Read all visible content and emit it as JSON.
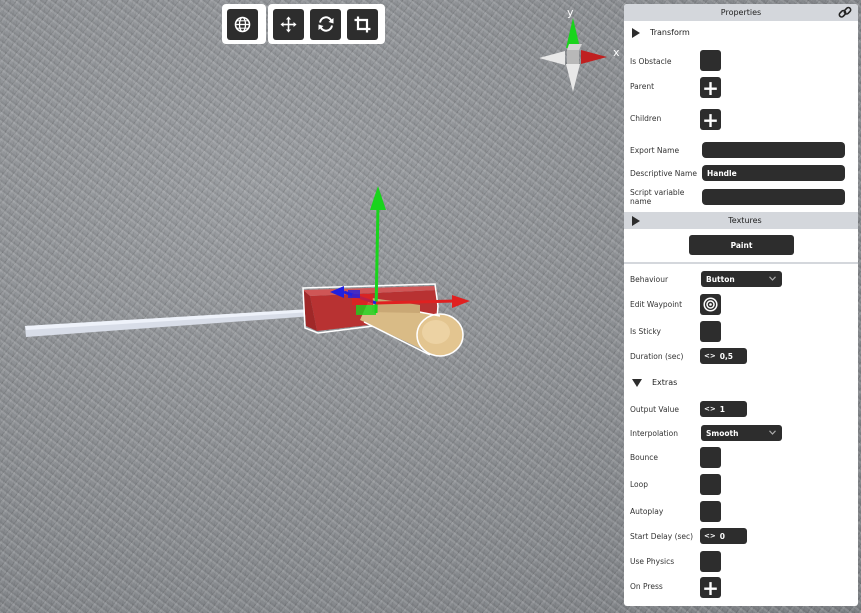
{
  "toolbar": {
    "groups": [
      {
        "buttons": [
          {
            "icon": "globe-icon"
          }
        ]
      },
      {
        "buttons": [
          {
            "icon": "move-icon"
          },
          {
            "icon": "rotate-icon"
          },
          {
            "icon": "crop-icon"
          }
        ]
      }
    ]
  },
  "gizmo": {
    "y_label": "y",
    "x_label": "x"
  },
  "panel": {
    "title": "Properties",
    "sections": {
      "transform": "Transform",
      "textures": "Textures",
      "extras": "Extras"
    },
    "fields": {
      "is_obstacle": "Is Obstacle",
      "parent": "Parent",
      "children": "Children",
      "export_name": {
        "label": "Export Name",
        "value": ""
      },
      "descriptive_name": {
        "label": "Descriptive Name",
        "value": "Handle"
      },
      "script_variable_name": {
        "label": "Script variable name",
        "value": ""
      },
      "paint": "Paint",
      "behaviour": {
        "label": "Behaviour",
        "value": "Button"
      },
      "edit_waypoint": "Edit Waypoint",
      "is_sticky": "Is Sticky",
      "duration": {
        "label": "Duration (sec)",
        "value": "0,5"
      },
      "output_value": {
        "label": "Output Value",
        "value": "1"
      },
      "interpolation": {
        "label": "Interpolation",
        "value": "Smooth"
      },
      "bounce": "Bounce",
      "loop": "Loop",
      "autoplay": "Autoplay",
      "start_delay": {
        "label": "Start Delay (sec)",
        "value": "0"
      },
      "use_physics": "Use Physics",
      "on_press": "On Press"
    }
  },
  "colors": {
    "button_dark": "#2d2d2d",
    "panel_header": "#d4d7dc",
    "axis_x": "#e02020",
    "axis_y": "#19d41c",
    "axis_z": "#2020e0",
    "handle_wood": "#e3c590",
    "box_red": "#b83232"
  }
}
